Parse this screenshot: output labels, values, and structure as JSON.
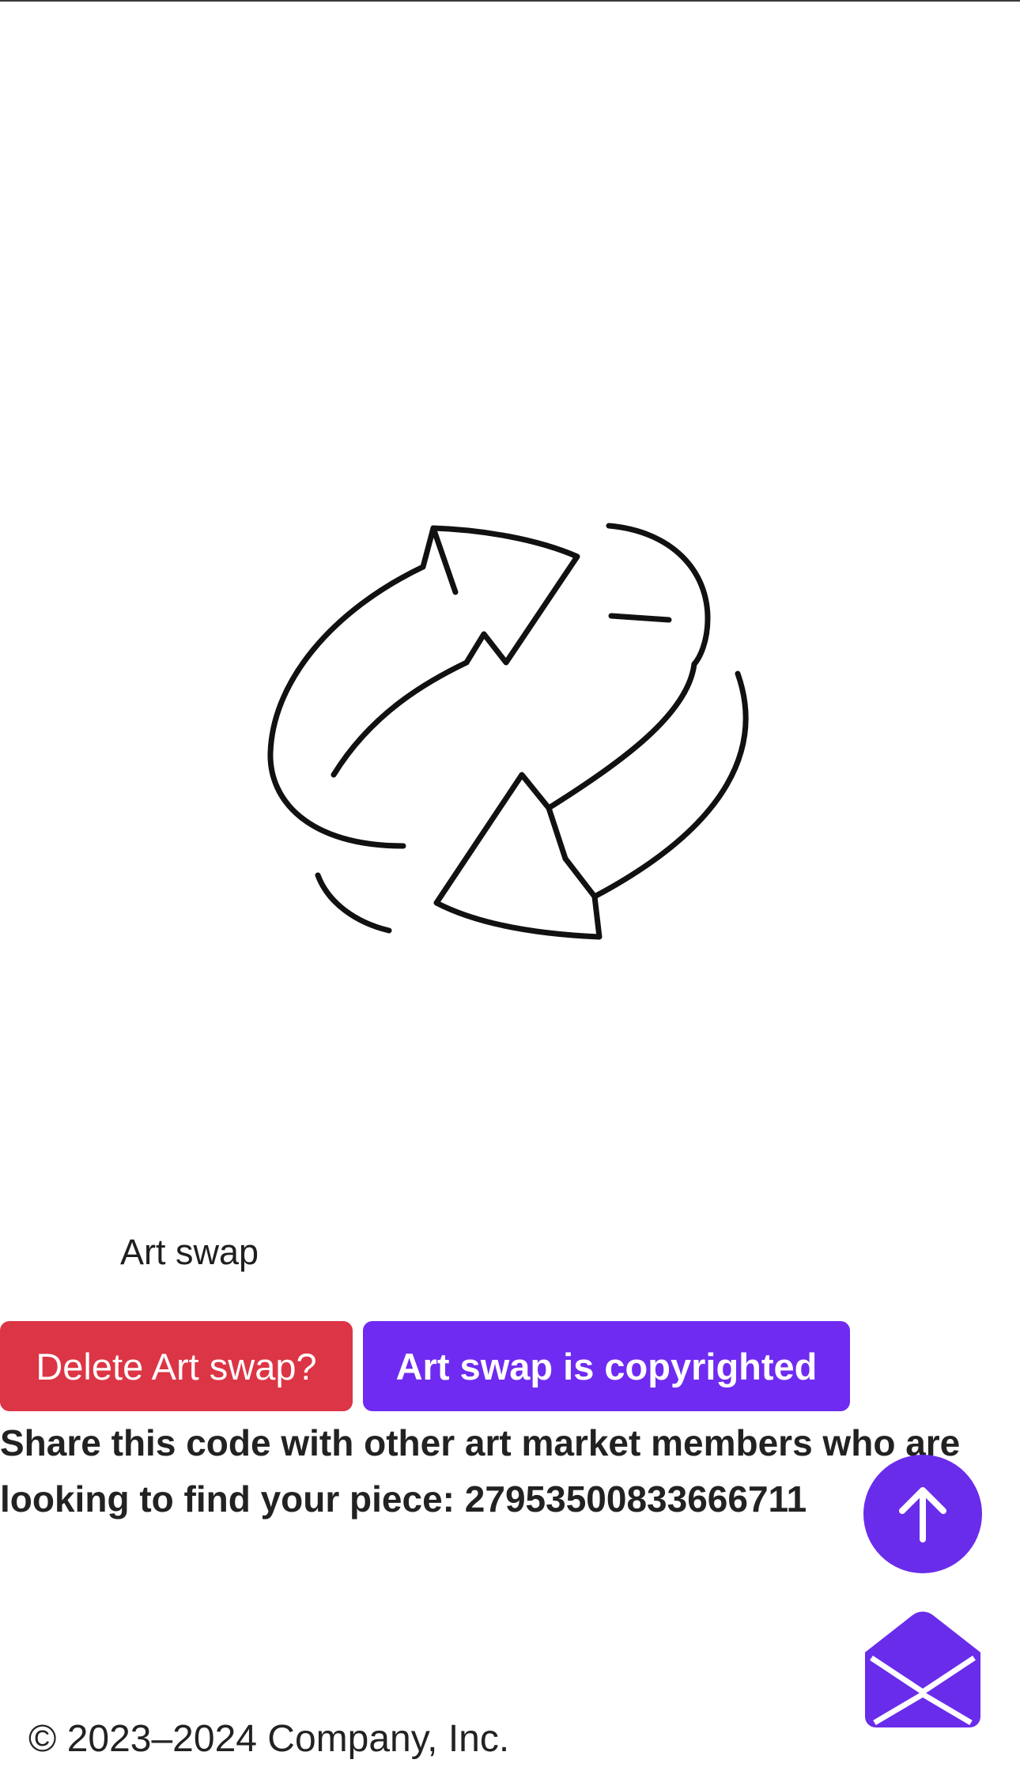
{
  "art": {
    "image_icon": "swap-arrows-icon",
    "title": "Art swap"
  },
  "actions": {
    "delete_label": "Delete Art swap?",
    "copyright_label": "Art swap is copyrighted",
    "delete_color": "#dc3545",
    "accent_color": "#6f2bf1"
  },
  "share": {
    "text": "Share this code with other art market members who are looking to find your piece: 27953500833666711"
  },
  "floating_buttons": {
    "scroll_top_icon": "arrow-up-icon",
    "mail_icon": "open-envelope-icon"
  },
  "footer": {
    "copyright": "© 2023–2024 Company, Inc."
  }
}
